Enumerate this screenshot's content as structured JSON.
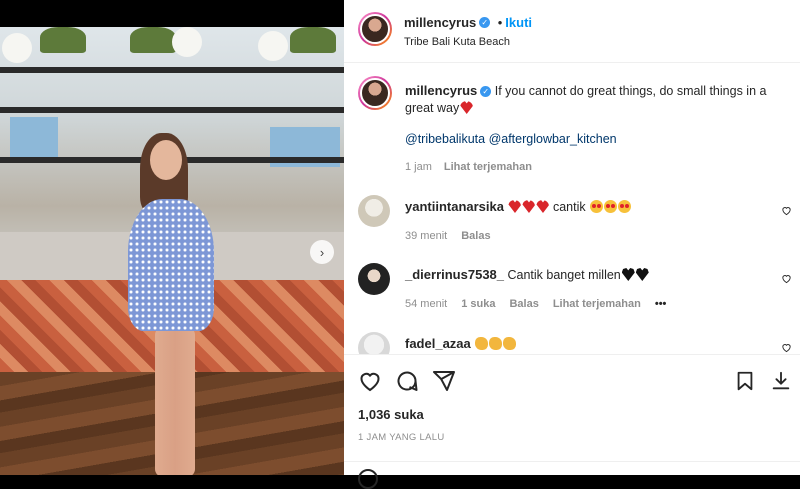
{
  "post": {
    "username": "millencyrus",
    "follow_label": "Ikuti",
    "location": "Tribe Bali Kuta Beach",
    "caption": "If you cannot do great things, do small things in a great way",
    "mentions": "@tribebalikuta @afterglowbar_kitchen",
    "caption_time": "1 jam",
    "translate_label": "Lihat terjemahan"
  },
  "comments": [
    {
      "username": "yantiintanarsika",
      "text": "cantik",
      "time": "39 menit",
      "reply": "Balas",
      "emoji_before": [
        "red-heart",
        "red-heart",
        "red-heart"
      ],
      "emoji_after": [
        "star-eyes",
        "star-eyes",
        "star-eyes"
      ]
    },
    {
      "username": "_dierrinus7538_",
      "text": "Cantik banget millen",
      "time": "54 menit",
      "likes": "1 suka",
      "reply": "Balas",
      "translate": "Lihat terjemahan",
      "more": "•••",
      "emoji_after": [
        "black-heart",
        "black-heart"
      ]
    },
    {
      "username": "fadel_azaa",
      "emoji_after": [
        "clapping-hands",
        "clapping-hands",
        "clapping-hands"
      ]
    }
  ],
  "stats": {
    "likes": "1,036 suka",
    "posted": "1 JAM YANG LALU"
  },
  "colors": {
    "accent": "#0095f6",
    "verified": "#3897f0",
    "muted": "#8e8e8e",
    "text": "#262626"
  },
  "icons": {
    "next": "chevron-right-icon",
    "like": "heart-icon",
    "comment": "comment-bubble-icon",
    "share": "paper-plane-icon",
    "save": "bookmark-icon",
    "download": "download-icon"
  }
}
